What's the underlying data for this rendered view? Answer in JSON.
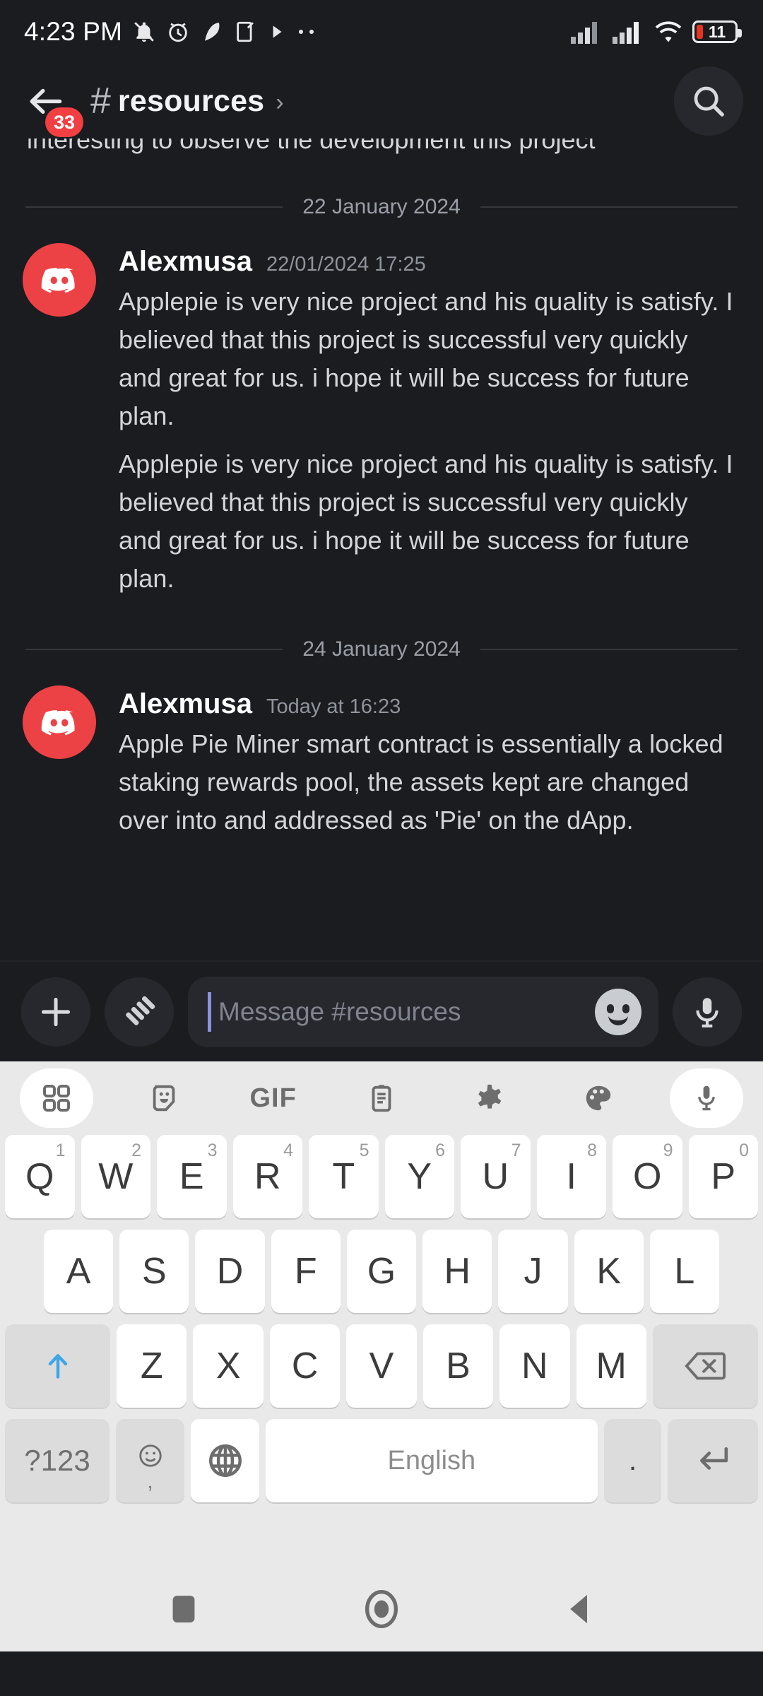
{
  "status_bar": {
    "time": "4:23 PM",
    "battery_percent": "11",
    "icons": [
      "bell-off-icon",
      "alarm-clock-icon",
      "feather-icon",
      "note-edit-icon",
      "play-triangle-icon",
      "more-dots-icon"
    ],
    "right_icons": [
      "signal-bars-icon",
      "signal-bars-icon",
      "wifi-icon",
      "battery-icon"
    ]
  },
  "header": {
    "back_icon": "arrow-left-icon",
    "unread_badge": "33",
    "hash": "#",
    "channel_name": "resources",
    "chevron": "›",
    "search_icon": "search-icon"
  },
  "messages": {
    "clipped_top_text": "interesting to observe the development this project",
    "groups": [
      {
        "date_divider": "22 January 2024",
        "author": "Alexmusa",
        "timestamp": "22/01/2024 17:25",
        "avatar": "discord-clyde-avatar",
        "lines": [
          "Applepie is very nice project and his quality is satisfy. I believed that this project is successful very quickly and great for us. i hope it will be success for future plan.",
          "Applepie is very nice project and his quality is satisfy. I believed that this project is successful very quickly and great for us. i hope it will be success for future plan."
        ]
      },
      {
        "date_divider": "24 January 2024",
        "author": "Alexmusa",
        "timestamp": "Today at 16:23",
        "avatar": "discord-clyde-avatar",
        "lines": [
          "Apple Pie Miner smart contract is essentially a locked staking rewards pool, the assets kept are changed over into and addressed as 'Pie' on the dApp."
        ]
      }
    ]
  },
  "input_bar": {
    "add_label": "+",
    "gift_icon": "nitro-gift-icon",
    "placeholder": "Message #resources",
    "value": "",
    "emoji_icon": "smiley-icon",
    "mic_icon": "microphone-icon"
  },
  "keyboard": {
    "toolbar": [
      {
        "name": "apps-grid-icon",
        "label": "",
        "pill": true
      },
      {
        "name": "sticker-icon",
        "label": "",
        "pill": false
      },
      {
        "name": "gif-icon",
        "label": "GIF",
        "pill": false
      },
      {
        "name": "clipboard-icon",
        "label": "",
        "pill": false
      },
      {
        "name": "gear-icon",
        "label": "",
        "pill": false
      },
      {
        "name": "palette-icon",
        "label": "",
        "pill": false
      },
      {
        "name": "microphone-icon",
        "label": "",
        "pill": true
      }
    ],
    "row1": [
      {
        "ch": "Q",
        "sup": "1"
      },
      {
        "ch": "W",
        "sup": "2"
      },
      {
        "ch": "E",
        "sup": "3"
      },
      {
        "ch": "R",
        "sup": "4"
      },
      {
        "ch": "T",
        "sup": "5"
      },
      {
        "ch": "Y",
        "sup": "6"
      },
      {
        "ch": "U",
        "sup": "7"
      },
      {
        "ch": "I",
        "sup": "8"
      },
      {
        "ch": "O",
        "sup": "9"
      },
      {
        "ch": "P",
        "sup": "0"
      }
    ],
    "row2": [
      {
        "ch": "A"
      },
      {
        "ch": "S"
      },
      {
        "ch": "D"
      },
      {
        "ch": "F"
      },
      {
        "ch": "G"
      },
      {
        "ch": "H"
      },
      {
        "ch": "J"
      },
      {
        "ch": "K"
      },
      {
        "ch": "L"
      }
    ],
    "row3": [
      {
        "ch": "Z"
      },
      {
        "ch": "X"
      },
      {
        "ch": "C"
      },
      {
        "ch": "V"
      },
      {
        "ch": "B"
      },
      {
        "ch": "N"
      },
      {
        "ch": "M"
      }
    ],
    "shift_icon": "shift-arrow-icon",
    "backspace_icon": "backspace-icon",
    "symbols_label": "?123",
    "comma_label": ",",
    "emoji_key_icon": "emoji-face-icon",
    "globe_icon": "language-globe-icon",
    "space_label": "English",
    "period_label": ".",
    "enter_icon": "enter-return-icon"
  },
  "nav_bar": {
    "recents_icon": "square-recents-icon",
    "home_icon": "circle-home-icon",
    "back_icon": "triangle-back-icon"
  },
  "colors": {
    "app_bg": "#1a1c20",
    "accent_red": "#ed4245",
    "badge_red": "#f23f42",
    "keyboard_bg": "#e9e9ea",
    "shift_blue": "#3da7e8",
    "battery_red": "#e8341f"
  }
}
